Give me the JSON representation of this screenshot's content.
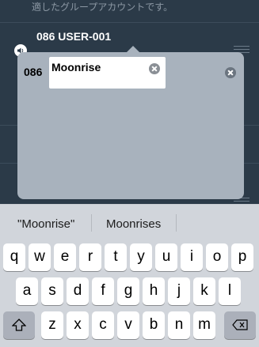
{
  "background": {
    "top_text": "適したグループアカウントです。",
    "row_title": "086 USER-001"
  },
  "popover": {
    "behind_label": "086",
    "field_value": "Moonrise"
  },
  "suggestions": [
    "\"Moonrise\"",
    "Moonrises",
    ""
  ],
  "keyboard": {
    "row1": [
      "q",
      "w",
      "e",
      "r",
      "t",
      "y",
      "u",
      "i",
      "o",
      "p"
    ],
    "row2": [
      "a",
      "s",
      "d",
      "f",
      "g",
      "h",
      "j",
      "k",
      "l"
    ],
    "row3": [
      "z",
      "x",
      "c",
      "v",
      "b",
      "n",
      "m"
    ],
    "shift_icon": "shift-icon",
    "delete_icon": "backspace-icon"
  }
}
